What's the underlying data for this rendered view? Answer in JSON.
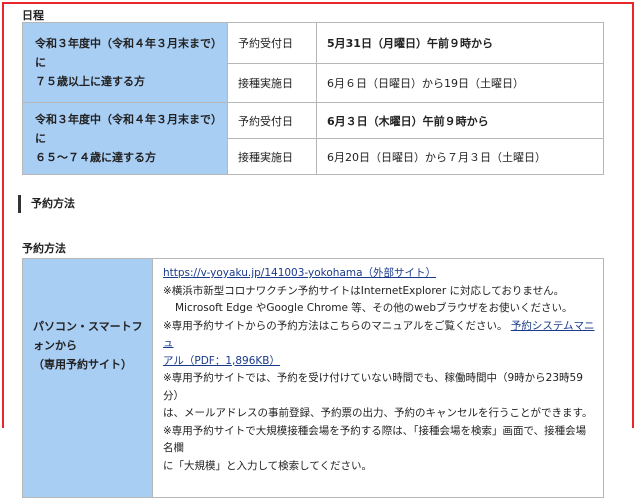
{
  "schedule": {
    "heading": "日程",
    "groups": [
      {
        "target_line1": "令和３年度中（令和４年３月末まで）に",
        "target_line2": "７５歳以上に達する方",
        "rows": [
          {
            "label": "予約受付日",
            "value": "5月31日（月曜日）午前９時から",
            "bold": true
          },
          {
            "label": "接種実施日",
            "value": "6月６日（日曜日）から19日（土曜日）",
            "bold": false
          }
        ]
      },
      {
        "target_line1": "令和３年度中（令和４年３月末まで）に",
        "target_line2": "６５～７４歳に達する方",
        "rows": [
          {
            "label": "予約受付日",
            "value": "6月３日（木曜日）午前９時から",
            "bold": true
          },
          {
            "label": "接種実施日",
            "value": "6月20日（日曜日）から７月３日（土曜日）",
            "bold": false
          }
        ]
      }
    ]
  },
  "method": {
    "section_heading": "予約方法",
    "sub_heading": "予約方法",
    "row_label_line1": "パソコン・スマートフ",
    "row_label_line2": "ォンから",
    "row_label_line3": "（専用予約サイト）",
    "link_text": "https://v-yoyaku.jp/141003-yokohama（外部サイト）",
    "note1": "※横浜市新型コロナワクチン予約サイトはInternetExplorer に対応しておりません。",
    "note1_cont": "Microsoft Edge やGoogle Chrome 等、その他のwebブラウザをお使いください。",
    "note2_prefix": "※専用予約サイトからの予約方法はこちらのマニュアルをご覧ください。",
    "manual_link_part1": "予約システムマニュ",
    "manual_link_part2": "アル（PDF：1,896KB）",
    "note3": "※専用予約サイトでは、予約を受け付けていない時間でも、稼働時間中（9時から23時59分）",
    "note3_cont": "は、メールアドレスの事前登録、予約票の出力、予約のキャンセルを行うことができます。",
    "note4": "※専用予約サイトで大規模接種会場を予約する際は、「接種会場を検索」画面で、接種会場名欄",
    "note4_cont": "に「大規模」と入力して検索してください。"
  },
  "colors": {
    "frame_border": "#e8262c",
    "label_cell_bg": "#a9cef4",
    "link": "#1a3a8c"
  }
}
